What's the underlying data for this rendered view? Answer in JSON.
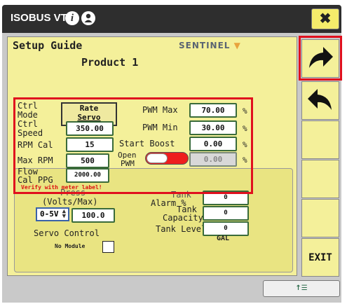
{
  "window": {
    "title": "ISOBUS VT",
    "close_label": "✖"
  },
  "header": {
    "title": "Setup Guide",
    "subtitle": "Product  1",
    "brand": "SENTINEL"
  },
  "settings": {
    "ctrl_mode_label_1": "Ctrl",
    "ctrl_mode_label_2": "Mode",
    "ctrl_mode_value_1": "Rate",
    "ctrl_mode_value_2": "Servo",
    "ctrl_speed_label_1": "Ctrl",
    "ctrl_speed_label_2": "Speed",
    "ctrl_speed_value": "350.00",
    "rpm_cal_label": "RPM Cal",
    "rpm_cal_value": "15",
    "max_rpm_label": "Max RPM",
    "max_rpm_value": "500",
    "flow_cal_label_1": "Flow",
    "flow_cal_label_2": "Cal PPG",
    "flow_cal_value": "2000.00",
    "verify_note": "Verify with meter label!",
    "pwm_max_label": "PWM Max",
    "pwm_max_value": "70.00",
    "pwm_min_label": "PWM Min",
    "pwm_min_value": "30.00",
    "start_boost_label": "Start Boost",
    "start_boost_value": "0.00",
    "open_pwm_label_1": "Open",
    "open_pwm_label_2": "PWM",
    "open_pwm_value": "0.00",
    "percent": "%"
  },
  "lower": {
    "press_label": "Press",
    "volts_label": "(Volts/Max)",
    "range_value": "0-5V",
    "max_value": "100.0",
    "servo_control_label": "Servo Control",
    "no_module_label": "No Module",
    "tank_alarm_label_1": "Tank",
    "tank_alarm_label_2": "Alarm %",
    "tank_alarm_value": "0",
    "tank_capacity_label_1": "Tank",
    "tank_capacity_label_2": "Capacity",
    "tank_capacity_value": "0",
    "tank_level_label": "Tank Level",
    "tank_level_value": "0",
    "unit": "GAL"
  },
  "sidebar": {
    "exit_label": "EXIT"
  },
  "footer": {
    "button_label": "↑☰"
  },
  "colors": {
    "panel": "#f4f09a",
    "title_bar": "#2e2e2e",
    "highlight": "#e0101e",
    "field_border": "#3a6b3a"
  }
}
